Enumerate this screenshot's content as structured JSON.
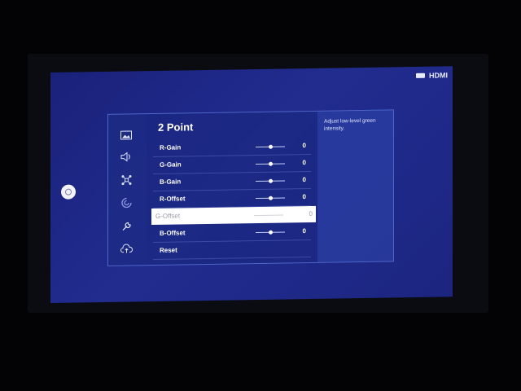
{
  "source": {
    "label": "HDMI",
    "icon": "hdmi-input-icon"
  },
  "side_button": {
    "icon": "settings-circle-icon"
  },
  "categories": [
    {
      "icon": "picture-icon",
      "active": true
    },
    {
      "icon": "sound-icon",
      "active": false
    },
    {
      "icon": "network-icon",
      "active": false
    },
    {
      "icon": "general-icon",
      "active": false
    },
    {
      "icon": "support-icon",
      "active": false
    },
    {
      "icon": "cloud-upload-icon",
      "active": false
    }
  ],
  "menu": {
    "title": "2 Point",
    "items": [
      {
        "label": "R-Gain",
        "value": "0",
        "level": 0.5
      },
      {
        "label": "G-Gain",
        "value": "0",
        "level": 0.5
      },
      {
        "label": "B-Gain",
        "value": "0",
        "level": 0.5
      },
      {
        "label": "R-Offset",
        "value": "0",
        "level": 0.5
      },
      {
        "label": "G-Offset",
        "value": "0",
        "level": 0.5,
        "selected": true
      },
      {
        "label": "B-Offset",
        "value": "0",
        "level": 0.5
      },
      {
        "label": "Reset"
      }
    ]
  },
  "description": "Adjust low-level green intensity.",
  "colors": {
    "screen": "#212c8f",
    "panel": "#2a3a9a",
    "selected": "#ffffff"
  }
}
